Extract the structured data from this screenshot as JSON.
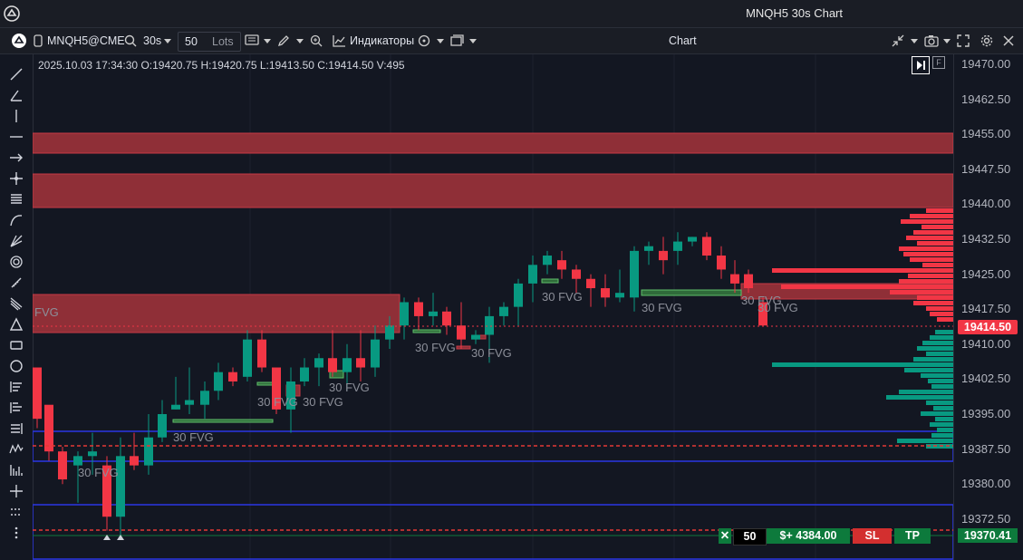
{
  "window": {
    "title": "MNQH5 30s Chart"
  },
  "toolbar": {
    "symbol": "MNQH5@CME",
    "timeframe": "30s",
    "quantity": "50",
    "unit": "Lots",
    "indicators": "Индикаторы",
    "center_title": "Chart"
  },
  "ohlc_text": "2025.10.03 17:34:30 O:19420.75 H:19420.75 L:19413.50 C:19414.50 V:495",
  "price_axis": {
    "labels": [
      "19470.00",
      "19462.50",
      "19455.00",
      "19447.50",
      "19440.00",
      "19432.50",
      "19425.00",
      "19417.50",
      "19410.00",
      "19402.50",
      "19395.00",
      "19387.50",
      "19380.00",
      "19372.50"
    ],
    "current_price": "19414.50",
    "tp_price": "19370.41"
  },
  "fvg_label": "30 FVG",
  "fvg_left_label": "FVG",
  "order_bar": {
    "close": "✕",
    "qty": "50",
    "pnl": "$+ 4384.00",
    "sl": "SL",
    "tp": "TP"
  },
  "colors": {
    "up": "#089981",
    "down": "#f23645",
    "zone": "#8f2f37",
    "blue": "#2934d9"
  }
}
